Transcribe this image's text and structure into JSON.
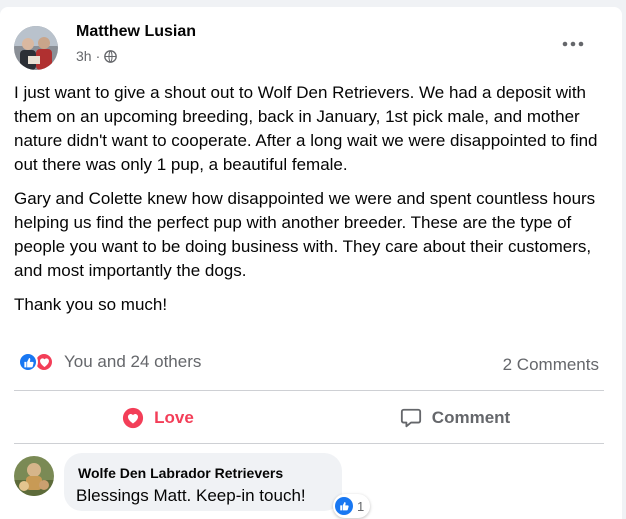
{
  "post": {
    "author": "Matthew Lusian",
    "time": "3h",
    "separator": "·",
    "paragraphs": [
      "I just want to give a shout out to Wolf Den Retrievers. We had a deposit with them on an upcoming breeding, back in January,  1st pick male, and mother nature didn't want to cooperate. After a long wait we were disappointed to find out there was only 1 pup, a beautiful female.",
      "Gary and Colette knew how disappointed we were and spent countless hours helping us find the perfect pup with another breeder. These are the type of people you want to be doing business with. They care about their customers, and most importantly the dogs.",
      "Thank you so much!"
    ],
    "reactions_text": "You and 24 others",
    "comments_count": "2 Comments"
  },
  "actions": {
    "love_label": "Love",
    "comment_label": "Comment"
  },
  "comment": {
    "author": "Wolfe Den Labrador Retrievers",
    "text": "Blessings Matt. Keep-in touch!",
    "like_count": "1"
  },
  "colors": {
    "like_blue": "#1877f2",
    "love_red": "#f33e58",
    "secondary_text": "#65676b"
  },
  "icons": [
    "globe-icon",
    "more-icon",
    "like-reaction-icon",
    "love-reaction-icon",
    "heart-icon",
    "comment-icon"
  ]
}
